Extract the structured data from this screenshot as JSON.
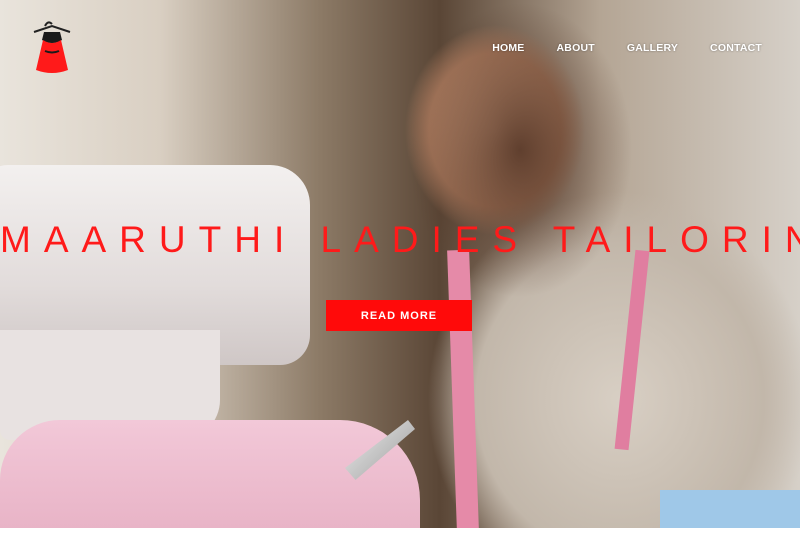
{
  "brand": {
    "logo_icon": "dress-hanger-icon",
    "accent_color": "#ff0a0a"
  },
  "nav": {
    "items": [
      {
        "label": "HOME"
      },
      {
        "label": "ABOUT"
      },
      {
        "label": "GALLERY"
      },
      {
        "label": "CONTACT"
      }
    ]
  },
  "hero": {
    "title": "MAARUTHI LADIES TAILORING",
    "button_label": "READ MORE",
    "background": "photo of woman sewing with sewing machine and measuring tape"
  }
}
